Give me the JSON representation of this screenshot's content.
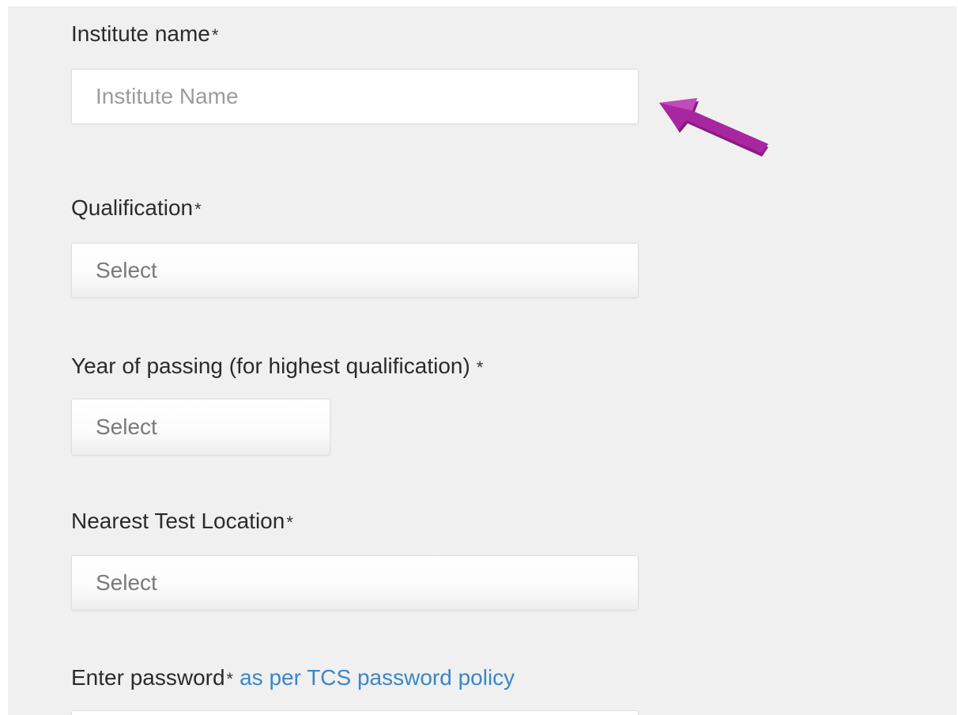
{
  "form": {
    "institute": {
      "label": "Institute name",
      "required_mark": "*",
      "placeholder": "Institute Name"
    },
    "qualification": {
      "label": "Qualification",
      "required_mark": "*",
      "selected": "Select"
    },
    "year_of_passing": {
      "label": "Year of passing (for highest qualification)",
      "required_mark": "*",
      "selected": "Select"
    },
    "test_location": {
      "label": "Nearest Test Location",
      "required_mark": "*",
      "selected": "Select"
    },
    "password": {
      "label": "Enter password",
      "required_mark": "*",
      "policy_link": "as per TCS password policy"
    }
  },
  "colors": {
    "panel_background": "#f0f0f0",
    "label_text": "#2b2b2b",
    "placeholder_text": "#9c9c9c",
    "link": "#3b86c6",
    "annotation_arrow": "#9b1f93"
  },
  "icons": {
    "annotation": "arrow-pointer-icon"
  }
}
